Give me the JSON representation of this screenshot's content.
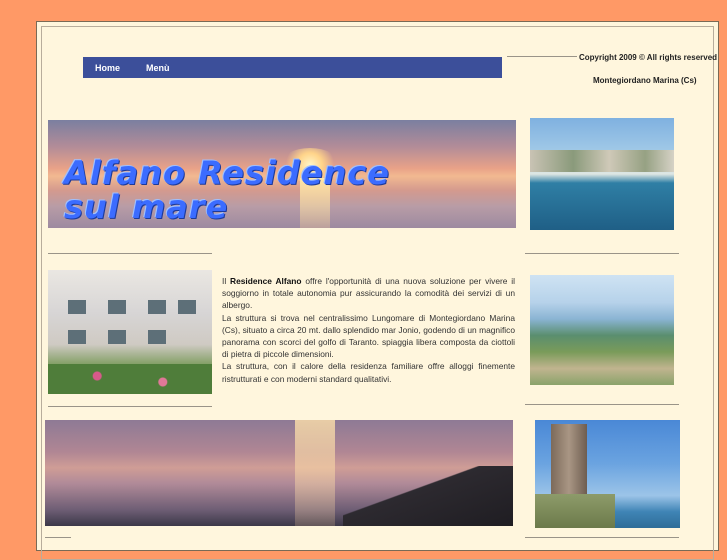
{
  "nav": {
    "items": [
      "Home",
      "Menù"
    ]
  },
  "header": {
    "copyright": "Copyright 2009 © All rights reserved",
    "location": "Montegiordano Marina (Cs)"
  },
  "banner": {
    "title_line1": "Alfano Residence",
    "title_line2": "sul mare"
  },
  "content": {
    "intro_prefix": "Il ",
    "intro_brand": "Residence Alfano",
    "intro_rest": " offre l'opportunità di una nuova soluzione per vivere il soggiorno in totale autonomia pur assicurando la comodità dei servizi di un albergo.",
    "paragraph2": "La struttura si trova nel centralissimo Lungomare di Montegiordano Marina (Cs), situato a circa 20 mt. dallo splendido mar Jonio, godendo di un magnifico panorama con scorci del golfo di Taranto. spiaggia libera composta da ciottoli di pietra di piccole dimensioni.",
    "paragraph3": "La struttura, con il calore della residenza familiare offre alloggi finemente ristrutturati e con moderni standard qualitativi."
  },
  "colors": {
    "page_background": "#FF9966",
    "panel_background": "#FFF6DD",
    "nav_background": "#3C4F9A",
    "banner_title": "#3B6CFF"
  }
}
